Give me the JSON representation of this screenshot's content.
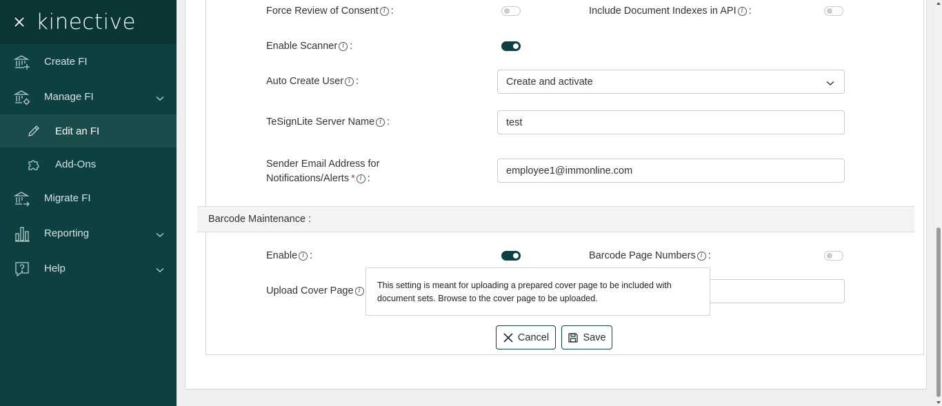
{
  "sidebar": {
    "logo": "kinective",
    "items": [
      {
        "label": "Create FI",
        "icon": "bank-plus-icon"
      },
      {
        "label": "Manage FI",
        "icon": "bank-gear-icon"
      },
      {
        "label": "Migrate FI",
        "icon": "bank-arrow-icon"
      },
      {
        "label": "Reporting",
        "icon": "bar-chart-icon"
      },
      {
        "label": "Help",
        "icon": "question-bubble-icon"
      }
    ],
    "subitems": [
      {
        "label": "Edit an FI",
        "icon": "pencil-icon"
      },
      {
        "label": "Add-Ons",
        "icon": "puzzle-icon"
      }
    ]
  },
  "form": {
    "force_review_label": "Force Review of Consent",
    "include_indexes_label": "Include Document Indexes in API",
    "enable_scanner_label": "Enable Scanner",
    "auto_create_user_label": "Auto Create User",
    "auto_create_user_value": "Create and activate",
    "server_name_label": "TeSignLite Server Name",
    "server_name_value": "test",
    "sender_email_label_line1": "Sender Email Address for",
    "sender_email_label_line2": "Notifications/Alerts",
    "sender_email_value": "employee1@immonline.com",
    "required_mark": "*",
    "colon": ":",
    "info_glyph": "i"
  },
  "toggles": {
    "force_review": false,
    "include_indexes": false,
    "enable_scanner": true,
    "barcode_enable": true,
    "barcode_page_numbers": false
  },
  "barcode": {
    "section_title": "Barcode Maintenance :",
    "enable_label": "Enable",
    "page_numbers_label": "Barcode Page Numbers",
    "upload_cover_label": "Upload Cover Page"
  },
  "tooltip": {
    "text": "This setting is meant for uploading a prepared cover page to be included with document sets. Browse to the cover page to be uploaded."
  },
  "actions": {
    "cancel_label": "Cancel",
    "save_label": "Save"
  },
  "colors": {
    "sidebar_bg": "#0d4040",
    "accent": "#0d4040",
    "required": "#d0312d"
  }
}
